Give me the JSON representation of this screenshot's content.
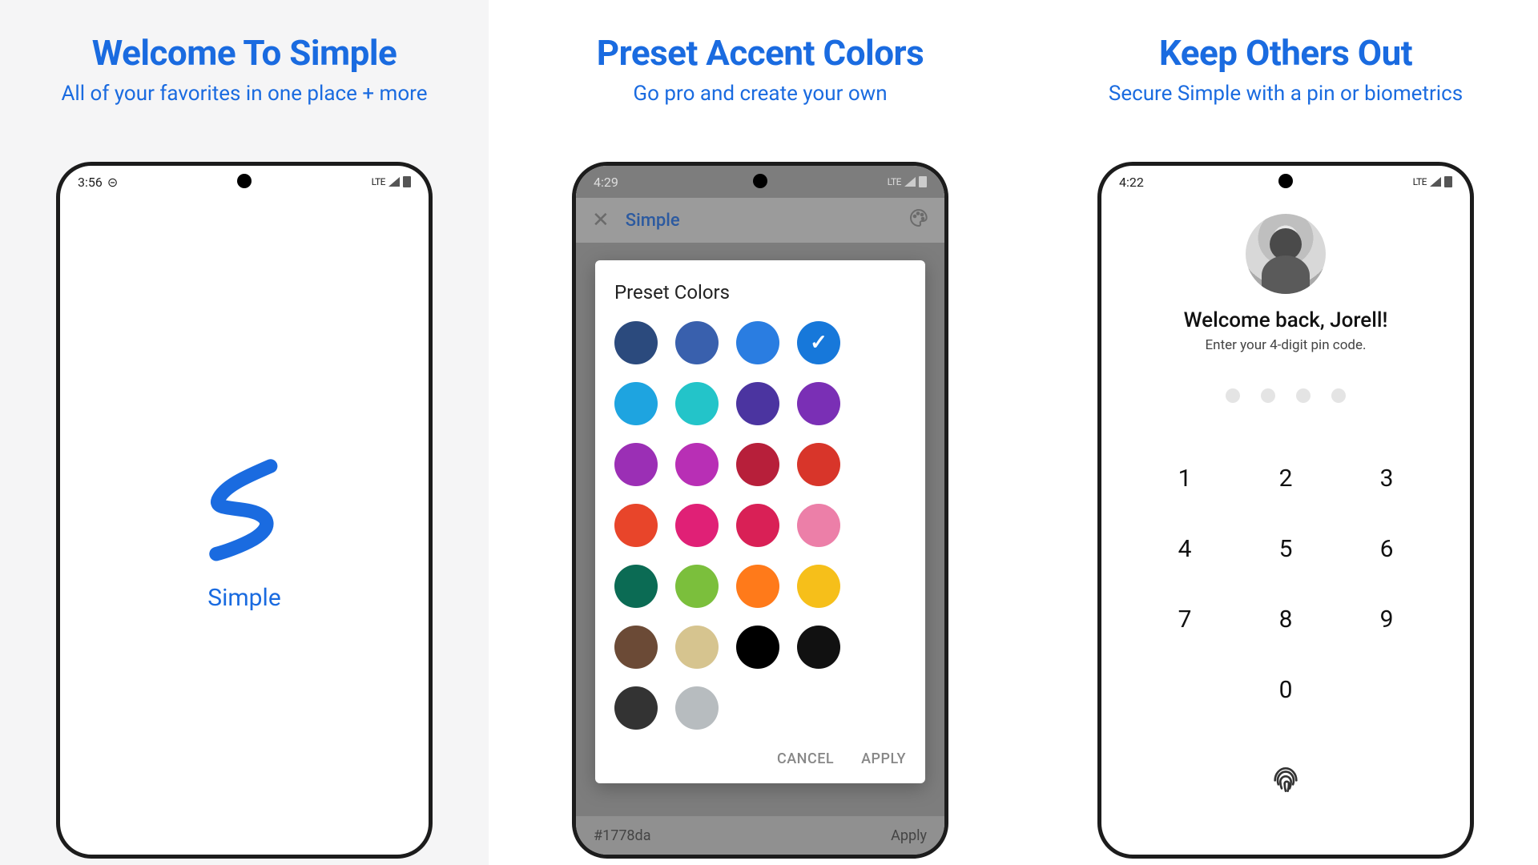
{
  "theme": {
    "accent": "#1a6be0"
  },
  "screens": {
    "left": {
      "headline": "Welcome To Simple",
      "subhead": "All of your favorites in one place + more",
      "status": {
        "time": "3:56",
        "net": "LTE"
      },
      "appName": "Simple"
    },
    "mid": {
      "headline": "Preset Accent Colors",
      "subhead": "Go pro and create your own",
      "status": {
        "time": "4:29",
        "net": "LTE"
      },
      "appbar": {
        "title": "Simple"
      },
      "dialog": {
        "title": "Preset Colors",
        "selectedIndex": 3,
        "colors": [
          "#2b4a7d",
          "#3960ad",
          "#2a7de1",
          "#1778da",
          "#1ea4e0",
          "#23c4c9",
          "#4b34a0",
          "#7a2fb5",
          "#9b2fb5",
          "#b82fb5",
          "#b71f3a",
          "#d8352a",
          "#e8452a",
          "#e02076",
          "#d92056",
          "#ec7fa8",
          "#0b6b54",
          "#7bbf3c",
          "#ff7a1a",
          "#f6bf1a",
          "#6b4a36",
          "#d6c48f",
          "#000000",
          "#111111",
          "#333333",
          "#b7bcbf"
        ],
        "cancel": "CANCEL",
        "apply": "APPLY"
      },
      "footer": {
        "hex": "#1778da",
        "applyLabel": "Apply"
      }
    },
    "right": {
      "headline": "Keep Others Out",
      "subhead": "Secure Simple with a pin or biometrics",
      "status": {
        "time": "4:22",
        "net": "LTE"
      },
      "welcomeBack": "Welcome back, Jorell!",
      "instruction": "Enter your 4-digit pin code.",
      "pinLength": 4,
      "keypad": [
        "1",
        "2",
        "3",
        "4",
        "5",
        "6",
        "7",
        "8",
        "9",
        "",
        "0",
        ""
      ]
    }
  }
}
